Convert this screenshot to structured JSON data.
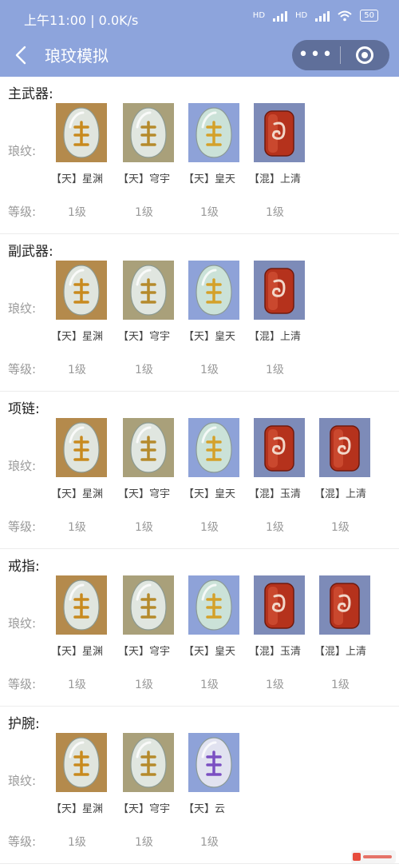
{
  "status": {
    "time": "上午11:00 | 0.0K/s",
    "net": "HD",
    "battery": "50"
  },
  "nav": {
    "title": "琅玟模拟"
  },
  "labels": {
    "wen": "琅纹:",
    "level": "等级:"
  },
  "sections": [
    {
      "title": "主武器:",
      "items": [
        {
          "name": "【天】星渊",
          "level": "1级",
          "gem": "gold"
        },
        {
          "name": "【天】穹宇",
          "level": "1级",
          "gem": "clear"
        },
        {
          "name": "【天】皇天",
          "level": "1级",
          "gem": "blue"
        },
        {
          "name": "【混】上清",
          "level": "1级",
          "gem": "red"
        }
      ]
    },
    {
      "title": "副武器:",
      "items": [
        {
          "name": "【天】星渊",
          "level": "1级",
          "gem": "gold"
        },
        {
          "name": "【天】穹宇",
          "level": "1级",
          "gem": "clear"
        },
        {
          "name": "【天】皇天",
          "level": "1级",
          "gem": "blue"
        },
        {
          "name": "【混】上清",
          "level": "1级",
          "gem": "red"
        }
      ]
    },
    {
      "title": "项链:",
      "items": [
        {
          "name": "【天】星渊",
          "level": "1级",
          "gem": "gold"
        },
        {
          "name": "【天】穹宇",
          "level": "1级",
          "gem": "clear"
        },
        {
          "name": "【天】皇天",
          "level": "1级",
          "gem": "blue"
        },
        {
          "name": "【混】玉清",
          "level": "1级",
          "gem": "red"
        },
        {
          "name": "【混】上清",
          "level": "1级",
          "gem": "red-blue"
        }
      ]
    },
    {
      "title": "戒指:",
      "items": [
        {
          "name": "【天】星渊",
          "level": "1级",
          "gem": "gold"
        },
        {
          "name": "【天】穹宇",
          "level": "1级",
          "gem": "clear"
        },
        {
          "name": "【天】皇天",
          "level": "1级",
          "gem": "blue"
        },
        {
          "name": "【混】玉清",
          "level": "1级",
          "gem": "red"
        },
        {
          "name": "【混】上清",
          "level": "1级",
          "gem": "red-blue"
        }
      ]
    },
    {
      "title": "护腕:",
      "items": [
        {
          "name": "【天】星渊",
          "level": "1级",
          "gem": "gold"
        },
        {
          "name": "【天】穹宇",
          "level": "1级",
          "gem": "clear"
        },
        {
          "name": "【天】云",
          "level": "1级",
          "gem": "purple"
        }
      ]
    }
  ],
  "colors": {
    "bar": "#8da4dc",
    "gold_bg": "#b48a4c",
    "clear_bg": "#a9a07a",
    "blue_bg": "#8ea2d8",
    "red_bg": "#7d8bb8",
    "red_stone": "#b5321c"
  }
}
